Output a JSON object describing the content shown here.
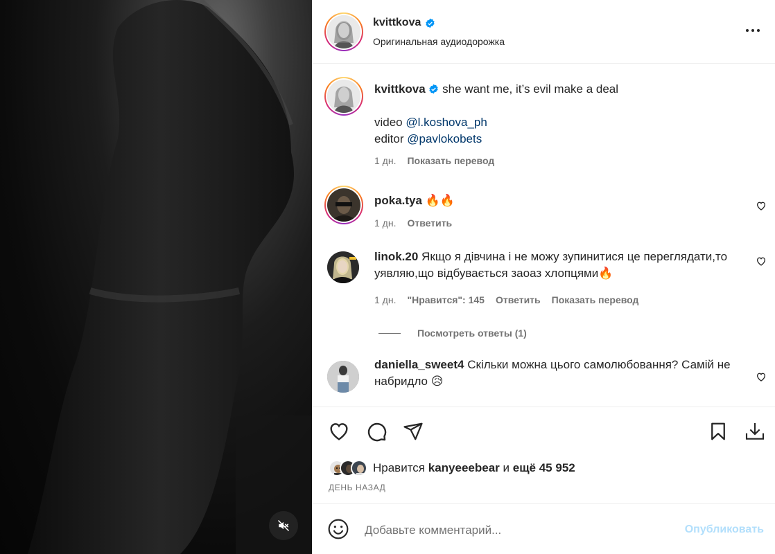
{
  "media": {
    "mute_icon": "speaker-muted-icon"
  },
  "post": {
    "author": "kvittkova",
    "audio": "Оригинальная аудиодорожка",
    "more_icon": "more-horizontal-icon"
  },
  "caption": {
    "username": "kvittkova",
    "text": "she want me, it’s evil make a deal",
    "line2_prefix": "video ",
    "line2_mention": "@l.koshova_ph",
    "line3_prefix": "editor ",
    "line3_mention": "@pavlokobets",
    "time": "1 дн.",
    "translate": "Показать перевод"
  },
  "comments": [
    {
      "username": "poka.tya",
      "text": "🔥🔥",
      "time": "1 дн.",
      "reply": "Ответить"
    },
    {
      "username": "linok.20",
      "text": "Якщо я дівчина і не можу зупинитися це переглядати,то уявляю,що відбувається заоаз хлопцями🔥",
      "time": "1 дн.",
      "likes": "\"Нравится\": 145",
      "reply": "Ответить",
      "translate": "Показать перевод",
      "view_replies": "Посмотреть ответы (1)"
    },
    {
      "username": "daniella_sweet4",
      "text": "Скільки можна цього самолюбовання? Самій не набридло 😥"
    }
  ],
  "actions": {
    "like_icon": "heart-icon",
    "comment_icon": "comment-icon",
    "share_icon": "share-icon",
    "save_icon": "bookmark-icon",
    "download_icon": "download-icon"
  },
  "likes": {
    "prefix": "Нравится",
    "user": "kanyeeebear",
    "middle": "и",
    "count": "ещё 45 952"
  },
  "date": "ДЕНЬ НАЗАД",
  "add_comment": {
    "placeholder": "Добавьте комментарий...",
    "publish": "Опубликовать",
    "emoji_icon": "smiley-icon"
  },
  "colors": {
    "accent_link": "#00376b",
    "publish_disabled": "#b2dffc",
    "verified": "#0095f6"
  }
}
